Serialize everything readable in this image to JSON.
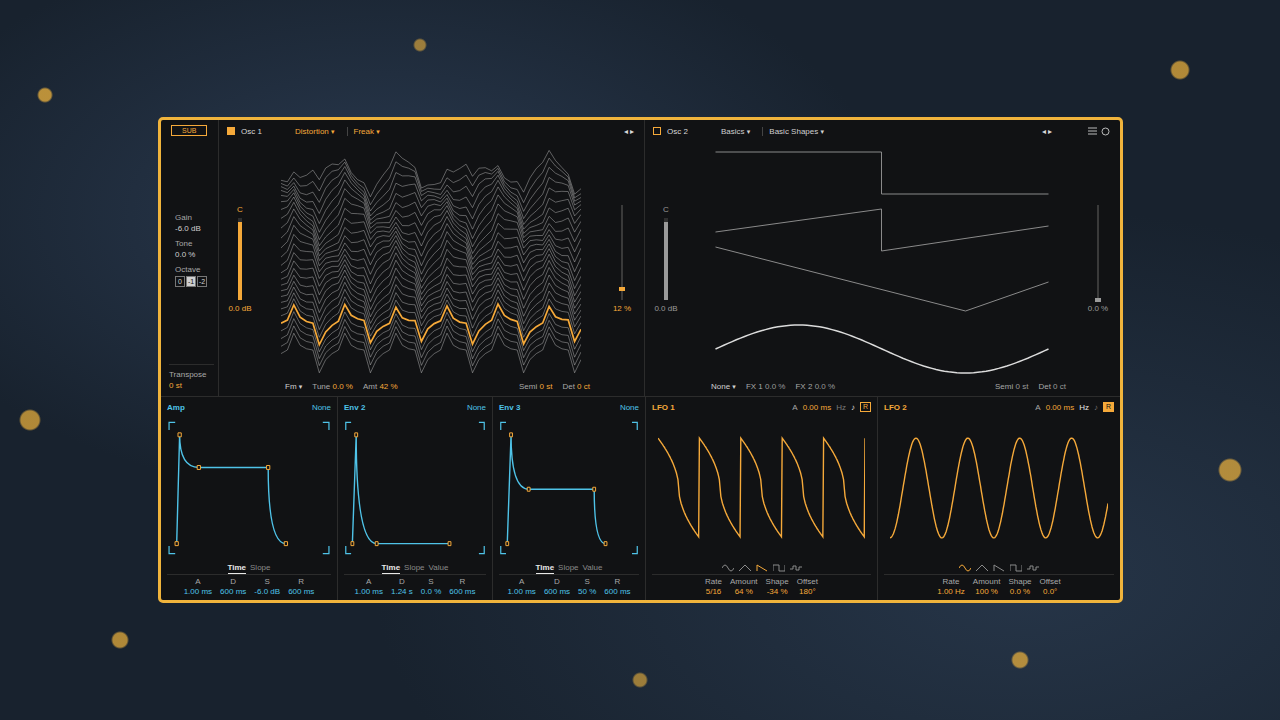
{
  "sub": {
    "button": "SUB",
    "params": [
      {
        "label": "Gain",
        "value": "-6.0 dB"
      },
      {
        "label": "Tone",
        "value": "0.0 %"
      }
    ],
    "octave": {
      "label": "Octave",
      "options": [
        {
          "label": "0",
          "selected": false
        },
        {
          "label": "-1",
          "selected": true
        },
        {
          "label": "-2",
          "selected": false
        }
      ]
    },
    "transpose": {
      "label": "Transpose",
      "value": "0 st"
    }
  },
  "oscillators": [
    {
      "title": "Osc 1",
      "on": true,
      "menus": [
        "Distortion",
        "Freak"
      ],
      "dropdown": "▾",
      "nav": [
        "◂",
        "▸"
      ],
      "has_menu": false,
      "gain": {
        "note": "C",
        "reading": "0.0 dB",
        "level": 0.95
      },
      "mix": {
        "reading": "12 %",
        "level": 0.12
      },
      "footer": {
        "mode": "Fm",
        "params": [
          {
            "label": "Tune",
            "value": "0.0 %"
          },
          {
            "label": "Amt",
            "value": "42 %"
          }
        ],
        "pitch": [
          {
            "label": "Semi",
            "value": "0 st"
          },
          {
            "label": "Det",
            "value": "0 ct"
          }
        ]
      },
      "display": {
        "kind": "wavetable",
        "layers": 26,
        "position": 0.17,
        "trace": [
          0.1,
          0.25,
          0.95,
          0.45,
          0.3,
          0.25,
          -0.7,
          -0.15,
          0.1,
          0.25,
          0.95,
          0.45,
          0.3,
          0.25,
          -0.7,
          -0.15,
          0.1,
          0.25,
          0.95,
          0.45,
          0.3,
          0.25,
          -0.7,
          -0.15,
          0.1,
          0.25,
          0.95,
          0.45,
          0.3,
          0.25,
          -0.7,
          -0.15,
          0.1,
          0.25,
          0.95,
          0.45,
          0.3,
          0.25,
          -0.7,
          -0.15,
          0.1,
          0.25,
          0.95,
          0.45,
          0.3,
          0.25,
          -0.7,
          -0.15
        ],
        "frames": []
      }
    },
    {
      "title": "Osc 2",
      "on": false,
      "menus": [
        "Basics",
        "Basic Shapes"
      ],
      "dropdown": "▾",
      "nav": [
        "◂",
        "▸"
      ],
      "has_menu": true,
      "gain": {
        "note": "C",
        "reading": "0.0 dB",
        "level": 0.95
      },
      "mix": {
        "reading": "0.0 %",
        "level": 0.0
      },
      "footer": {
        "mode": "None",
        "params": [
          {
            "label": "FX 1",
            "value": "0.0 %"
          },
          {
            "label": "FX 2",
            "value": "0.0 %"
          }
        ],
        "pitch": [
          {
            "label": "Semi",
            "value": "0 st"
          },
          {
            "label": "Det",
            "value": "0 ct"
          }
        ]
      },
      "display": {
        "kind": "shapes",
        "layers": 0,
        "position": 0,
        "trace": [],
        "frames": [
          "square",
          "saw",
          "triangle",
          "sine"
        ]
      }
    }
  ],
  "envelopes": [
    {
      "title": "Amp",
      "target": "None",
      "tabs": [
        {
          "label": "Time",
          "selected": true
        },
        {
          "label": "Slope",
          "selected": false
        }
      ],
      "params": [
        {
          "label": "A",
          "value": "1.00 ms"
        },
        {
          "label": "D",
          "value": "600 ms"
        },
        {
          "label": "S",
          "value": "-6.0 dB"
        },
        {
          "label": "R",
          "value": "600 ms"
        }
      ],
      "nodes": [
        [
          0.01,
          0
        ],
        [
          0.03,
          1
        ],
        [
          0.16,
          0.7
        ],
        [
          0.63,
          0.7
        ],
        [
          0.75,
          0
        ]
      ]
    },
    {
      "title": "Env 2",
      "target": "None",
      "tabs": [
        {
          "label": "Time",
          "selected": true
        },
        {
          "label": "Slope",
          "selected": false
        },
        {
          "label": "Value",
          "selected": false
        }
      ],
      "params": [
        {
          "label": "A",
          "value": "1.00 ms"
        },
        {
          "label": "D",
          "value": "1.24 s"
        },
        {
          "label": "S",
          "value": "0.0 %"
        },
        {
          "label": "R",
          "value": "600 ms"
        }
      ],
      "nodes": [
        [
          0.01,
          0
        ],
        [
          0.04,
          1
        ],
        [
          0.2,
          0
        ],
        [
          0.77,
          0
        ]
      ]
    },
    {
      "title": "Env 3",
      "target": "None",
      "tabs": [
        {
          "label": "Time",
          "selected": true
        },
        {
          "label": "Slope",
          "selected": false
        },
        {
          "label": "Value",
          "selected": false
        }
      ],
      "params": [
        {
          "label": "A",
          "value": "1.00 ms"
        },
        {
          "label": "D",
          "value": "600 ms"
        },
        {
          "label": "S",
          "value": "50 %"
        },
        {
          "label": "R",
          "value": "600 ms"
        }
      ],
      "nodes": [
        [
          0.01,
          0
        ],
        [
          0.04,
          1
        ],
        [
          0.18,
          0.5
        ],
        [
          0.7,
          0.5
        ],
        [
          0.79,
          0
        ]
      ]
    }
  ],
  "lfos": [
    {
      "title": "LFO 1",
      "attack_label": "A",
      "attack": "0.00 ms",
      "units": [
        {
          "label": "Hz",
          "selected": false
        },
        {
          "label": "♪",
          "selected": true
        }
      ],
      "retrigger": {
        "label": "R",
        "on": false
      },
      "cycles": 5,
      "shapes": [
        {
          "kind": "sine",
          "selected": false
        },
        {
          "kind": "triangle",
          "selected": false
        },
        {
          "kind": "saw",
          "selected": true
        },
        {
          "kind": "square",
          "selected": false
        },
        {
          "kind": "random",
          "selected": false
        }
      ],
      "params": [
        {
          "label": "Rate",
          "value": "5/16"
        },
        {
          "label": "Amount",
          "value": "64 %"
        },
        {
          "label": "Shape",
          "value": "-34 %"
        },
        {
          "label": "Offset",
          "value": "180°"
        }
      ]
    },
    {
      "title": "LFO 2",
      "attack_label": "A",
      "attack": "0.00 ms",
      "units": [
        {
          "label": "Hz",
          "selected": true
        },
        {
          "label": "♪",
          "selected": false
        }
      ],
      "retrigger": {
        "label": "R",
        "on": true
      },
      "cycles": 4.2,
      "shapes": [
        {
          "kind": "sine",
          "selected": true
        },
        {
          "kind": "triangle",
          "selected": false
        },
        {
          "kind": "saw",
          "selected": false
        },
        {
          "kind": "square",
          "selected": false
        },
        {
          "kind": "random",
          "selected": false
        }
      ],
      "params": [
        {
          "label": "Rate",
          "value": "1.00 Hz"
        },
        {
          "label": "Amount",
          "value": "100 %"
        },
        {
          "label": "Shape",
          "value": "0.0 %"
        },
        {
          "label": "Offset",
          "value": "0.0°"
        }
      ]
    }
  ]
}
